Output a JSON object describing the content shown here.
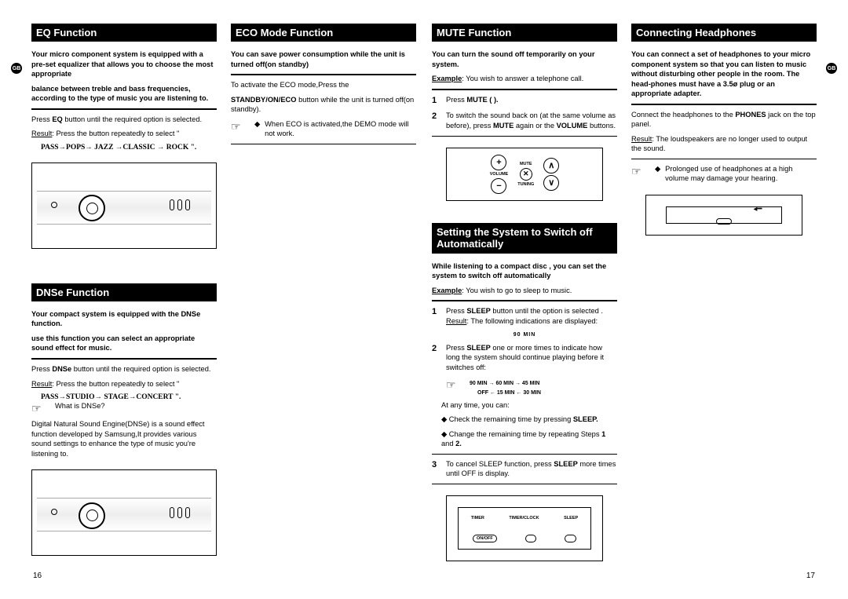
{
  "gb_label": "GB",
  "left_page": {
    "eq": {
      "title": "EQ Function",
      "intro1": "Your micro component system is equipped with a pre-set equalizer that allows you to choose the most appropriate",
      "intro2": "balance between treble and bass frequencies, according to the type of music you are listening to.",
      "step_a": "Press ",
      "step_b": "EQ",
      "step_c": " button until the required option is selected.",
      "result_a": "Result",
      "result_b": ": Press the button repeatedly to select \"",
      "seq": "PASS→POPS→ JAZZ →CLASSIC → ROCK "
    },
    "eco": {
      "title": "ECO Mode Function",
      "intro": "You can save power consumption while the unit is turned off(on standby)",
      "step1": "To activate the ECO mode,Press the",
      "step2a": "STANDBY/ON/ECO",
      "step2b": " button while the unit is turned off(on standby).",
      "note": "When ECO is activated,the DEMO mode will not work."
    },
    "dnse": {
      "title": "DNSe Function",
      "intro1": "Your compact system is equipped with the DNSe function.",
      "intro2": "use this function you can select an appropriate sound effect for music.",
      "step_a": "Press ",
      "step_b": "DNSe",
      "step_c": " button until the required option is selected.",
      "result_a": "Result",
      "result_b": ": Press the button repeatedly to select \"",
      "seq": "PASS→STUDIO→ STAGE→CONCERT ",
      "q": "What is DNSe?",
      "desc": "Digital Natural Sound Engine(DNSe) is a sound effect function developed by Samsung,It provides various sound settings to enhance the type of music you're listening to."
    },
    "pagenum": "16"
  },
  "right_page": {
    "mute": {
      "title": "MUTE Function",
      "intro": "You can turn the sound off temporarily on your system.",
      "ex_a": "Example",
      "ex_b": ": You wish to answer a telephone call.",
      "s1a": "Press ",
      "s1b": "MUTE (      ).",
      "s2a": "To switch the sound back on (at the same volume as before), press ",
      "s2b": "MUTE",
      "s2c": " again or the ",
      "s2d": "VOLUME",
      "s2e": " buttons.",
      "labels": {
        "mute": "MUTE",
        "volume": "VOLUME",
        "tuning": "TUNING"
      }
    },
    "sleep": {
      "title": "Setting the System to Switch off Automatically",
      "intro": "While listening to a compact disc , you can set the system to switch off automatically",
      "ex_a": "Example",
      "ex_b": ": You wish to go to sleep to music.",
      "s1a": "Press ",
      "s1b": "SLEEP",
      "s1c": " button until the option is selected .",
      "s1r_a": "Result",
      "s1r_b": ": The following indications are displayed:",
      "display": "90        MIN",
      "s2a": "Press ",
      "s2b": "SLEEP",
      "s2c": " one or more times to indicate how long the system should continue playing before it switches off:",
      "seq1": "90 MIN → 60 MIN → 45 MIN",
      "seq2": "OFF ← 15 MIN ← 30 MIN",
      "any": "At any time, you can:",
      "b1a": "Check the remaining time by pressing ",
      "b1b": "SLEEP.",
      "b2a": "Change the remaining time by repeating Steps ",
      "b2b": "1",
      "b2c": " and ",
      "b2d": "2.",
      "s3a": "To cancel SLEEP function, press ",
      "s3b": "SLEEP",
      "s3c": " more times until OFF is display.",
      "btns": {
        "timer": "TIMER",
        "tc": "TIMER/CLOCK",
        "sleep": "SLEEP",
        "onoff": "ON/OFF"
      }
    },
    "head": {
      "title": "Connecting Headphones",
      "intro": "You can connect a set of headphones to your micro component system so that you can listen to music without disturbing other people in the room. The head-phones must have a 3.5ø plug or an appropriate adapter.",
      "step_a": "Connect the headphones to the ",
      "step_b": "PHONES",
      "step_c": " jack on the top panel.",
      "res_a": "Result",
      "res_b": ": The loudspeakers are no longer used to output the sound.",
      "note": "Prolonged use of headphones at a high volume may damage your hearing."
    },
    "pagenum": "17"
  }
}
